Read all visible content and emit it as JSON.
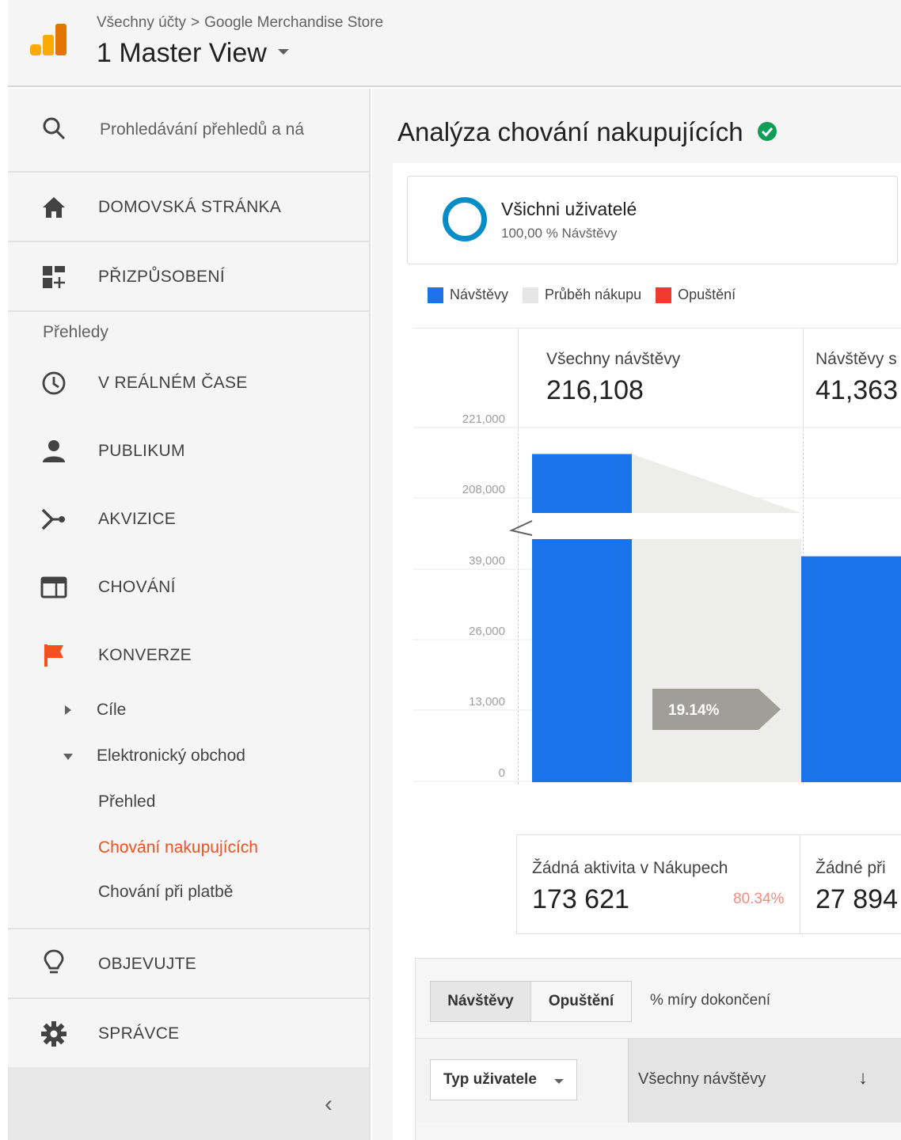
{
  "header": {
    "breadcrumb_all": "Všechny účty",
    "breadcrumb_sep": ">",
    "breadcrumb_property": "Google Merchandise Store",
    "view_name": "1 Master View"
  },
  "sidebar": {
    "search_placeholder": "Prohledávání přehledů a ná",
    "home": "DOMOVSKÁ STRÁNKA",
    "customize": "PŘIZPŮSOBENÍ",
    "reports_section": "Přehledy",
    "realtime": "V REÁLNÉM ČASE",
    "audience": "PUBLIKUM",
    "acquisition": "AKVIZICE",
    "behavior": "CHOVÁNÍ",
    "conversions": "KONVERZE",
    "goals": "Cíle",
    "ecommerce": "Elektronický obchod",
    "overview": "Přehled",
    "shopping_behavior": "Chování nakupujících",
    "checkout_behavior": "Chování při platbě",
    "discover": "OBJEVUJTE",
    "admin": "SPRÁVCE",
    "collapse": "‹"
  },
  "main": {
    "title": "Analýza chování nakupujících",
    "segment": {
      "name": "Všichni uživatelé",
      "share": "100,00 % Návštěvy"
    },
    "legend": [
      {
        "label": "Návštěvy",
        "color": "#1a73e8"
      },
      {
        "label": "Průběh nákupu",
        "color": "#e6e6e6"
      },
      {
        "label": "Opuštění",
        "color": "#ef3b2c"
      }
    ],
    "table": {
      "tab_sessions": "Návštěvy",
      "tab_abandon": "Opuštění",
      "tab_completion": "% míry dokončení",
      "dimension_button": "Typ uživatele",
      "column_header": "Všechny návštěvy",
      "sort_icon": "↓"
    }
  },
  "chart_data": {
    "type": "bar",
    "ticks": [
      "221,000",
      "208,000",
      "39,000",
      "26,000",
      "13,000",
      "0"
    ],
    "axis_break": true,
    "categories": [
      "Všechny návštěvy",
      "Návštěvy s"
    ],
    "values": [
      216108,
      41363
    ],
    "value_labels": [
      "216,108",
      "41,363"
    ],
    "conversion_rate": "19.14%",
    "abandonment": [
      {
        "label": "Žádná aktivita v Nákupech",
        "value": "173 621",
        "rate": "80.34%"
      },
      {
        "label": "Žádné při",
        "value": "27 894",
        "rate": ""
      }
    ]
  }
}
